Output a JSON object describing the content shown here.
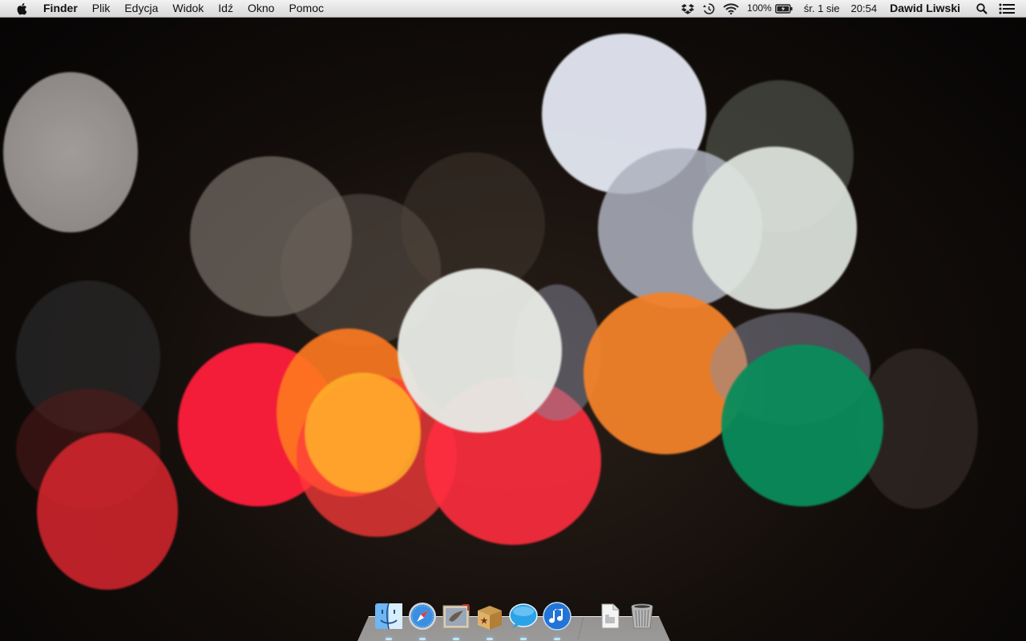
{
  "menubar": {
    "app_name": "Finder",
    "menus": [
      "Plik",
      "Edycja",
      "Widok",
      "Idź",
      "Okno",
      "Pomoc"
    ],
    "status": {
      "dropbox_icon": "dropbox-icon",
      "time_machine_icon": "time-machine-icon",
      "wifi_icon": "wifi-icon",
      "battery_percent": "100%",
      "battery_icon": "battery-charging-icon",
      "date": "śr. 1 sie",
      "time": "20:54",
      "user": "Dawid Liwski",
      "spotlight_icon": "spotlight-search-icon",
      "notifications_icon": "notification-center-icon"
    }
  },
  "dock": {
    "apps": [
      {
        "name": "Finder",
        "icon": "finder-icon",
        "running": true
      },
      {
        "name": "Safari",
        "icon": "safari-icon",
        "running": true
      },
      {
        "name": "Mail",
        "icon": "mail-icon",
        "running": true
      },
      {
        "name": "Sparrow",
        "icon": "sparrow-box-icon",
        "running": true
      },
      {
        "name": "Messages",
        "icon": "messages-icon",
        "running": true
      },
      {
        "name": "iTunes",
        "icon": "itunes-icon",
        "running": true
      }
    ],
    "stacks": [
      {
        "name": "Documents",
        "icon": "document-stack-icon"
      },
      {
        "name": "Trash",
        "icon": "trash-icon"
      }
    ]
  },
  "colors": {
    "bokeh_red": "#ff1f3a",
    "bokeh_orange": "#f07a22",
    "bokeh_green": "#0a8a5a",
    "bokeh_white": "#e8eef2"
  }
}
